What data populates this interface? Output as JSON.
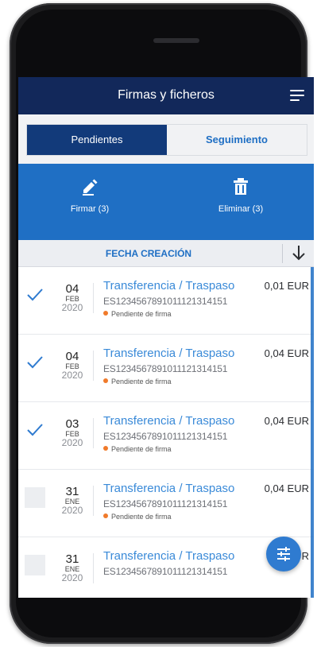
{
  "header": {
    "title": "Firmas y ficheros",
    "menu_icon": "hamburger-menu-icon"
  },
  "tabs": [
    {
      "label": "Pendientes",
      "active": true
    },
    {
      "label": "Seguimiento",
      "active": false
    }
  ],
  "actions": {
    "sign": {
      "label": "Firmar (3)",
      "icon": "pencil-icon"
    },
    "delete": {
      "label": "Eliminar (3)",
      "icon": "trash-icon"
    }
  },
  "sort": {
    "label": "FECHA CREACIÓN",
    "icon": "arrow-down-icon"
  },
  "items": [
    {
      "checked": true,
      "day": "04",
      "month": "FEB",
      "year": "2020",
      "title": "Transferencia / Traspaso",
      "account": "ES1234567891011121314151",
      "status": "Pendiente de firma",
      "amount": "0,01 EUR"
    },
    {
      "checked": true,
      "day": "04",
      "month": "FEB",
      "year": "2020",
      "title": "Transferencia / Traspaso",
      "account": "ES1234567891011121314151",
      "status": "Pendiente de firma",
      "amount": "0,04 EUR"
    },
    {
      "checked": true,
      "day": "03",
      "month": "FEB",
      "year": "2020",
      "title": "Transferencia / Traspaso",
      "account": "ES1234567891011121314151",
      "status": "Pendiente de firma",
      "amount": "0,04 EUR"
    },
    {
      "checked": false,
      "day": "31",
      "month": "ENE",
      "year": "2020",
      "title": "Transferencia / Traspaso",
      "account": "ES1234567891011121314151",
      "status": "Pendiente de firma",
      "amount": "0,04 EUR"
    },
    {
      "checked": false,
      "day": "31",
      "month": "ENE",
      "year": "2020",
      "title": "Transferencia / Traspaso",
      "account": "ES1234567891011121314151",
      "status": "",
      "amount": "R"
    }
  ],
  "fab": {
    "icon": "filter-icon"
  },
  "colors": {
    "header": "#12285a",
    "accent": "#1f6fc4",
    "status_dot": "#f07a2a"
  }
}
